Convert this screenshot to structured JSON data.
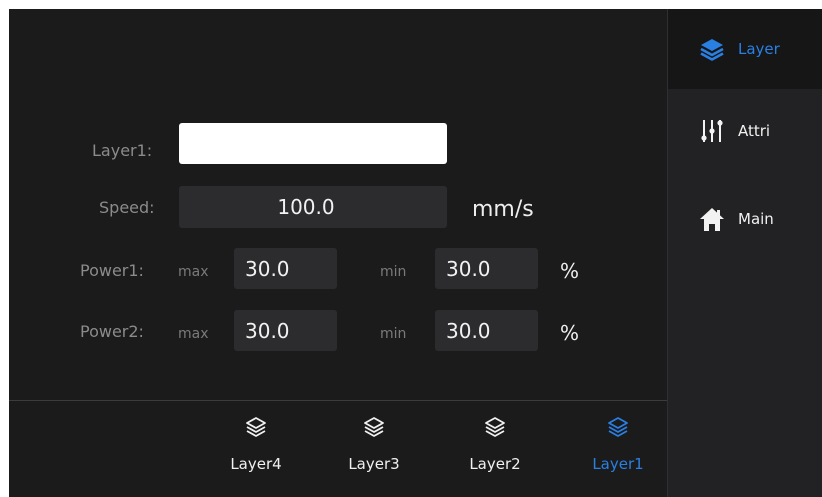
{
  "form": {
    "layer_label": "Layer1:",
    "layer_name_value": "",
    "speed_label": "Speed:",
    "speed_value": "100.0",
    "speed_unit": "mm/s",
    "power1_label": "Power1:",
    "power2_label": "Power2:",
    "max_label": "max",
    "min_label": "min",
    "power1_max": "30.0",
    "power1_min": "30.0",
    "power2_max": "30.0",
    "power2_min": "30.0",
    "percent_unit": "%"
  },
  "bottom_tabs": [
    {
      "label": "Layer4",
      "icon": "layers-icon",
      "active": false
    },
    {
      "label": "Layer3",
      "icon": "layers-icon",
      "active": false
    },
    {
      "label": "Layer2",
      "icon": "layers-icon",
      "active": false
    },
    {
      "label": "Layer1",
      "icon": "layers-icon",
      "active": true
    }
  ],
  "sidebar": {
    "items": [
      {
        "label": "Layer",
        "icon": "layers-icon",
        "active": true
      },
      {
        "label": "Attri",
        "icon": "sliders-icon",
        "active": false
      },
      {
        "label": "Main",
        "icon": "home-icon",
        "active": false
      }
    ]
  },
  "colors": {
    "background": "#1b1b1c",
    "sidebar": "#222224",
    "field": "#2c2c2e",
    "accent": "#2a7fe3",
    "text": "#f2f2f2",
    "label": "#8b8b8b"
  }
}
